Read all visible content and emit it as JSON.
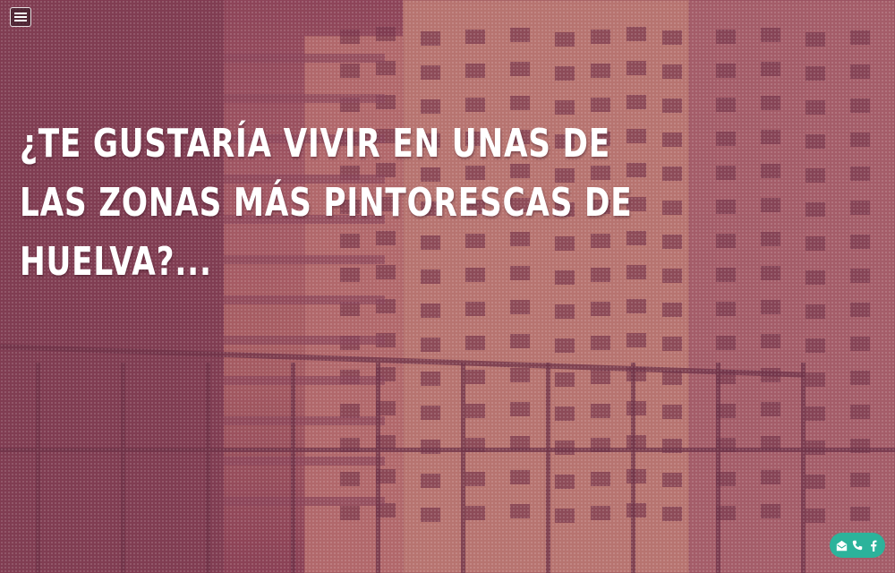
{
  "header": {
    "menu_button_label": "menu-icon"
  },
  "hero": {
    "headline": "¿TE GUSTARÍA VIVIR EN UNAS DE LAS ZONAS MÁS PINTORESCAS DE HUELVA?...",
    "background_image_description_icon": "building-photo",
    "tint_color": "#8c3c55"
  },
  "contact_bar": {
    "email_icon": "email-icon",
    "phone_icon": "phone-icon",
    "facebook_icon": "facebook-icon",
    "accent_color": "#2bb39b"
  }
}
